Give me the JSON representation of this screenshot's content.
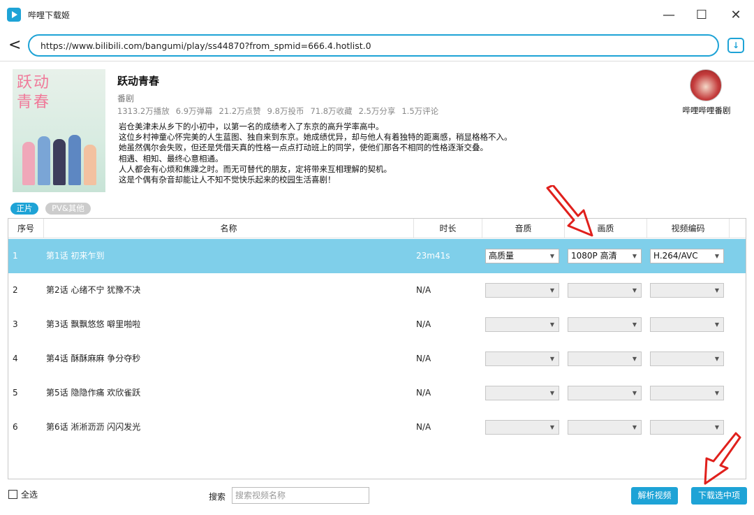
{
  "window": {
    "title": "哔哩下载姬",
    "minimize": "—",
    "maximize": "☐",
    "close": "✕"
  },
  "address": {
    "back": "<",
    "url": "https://www.bilibili.com/bangumi/play/ss44870?from_spmid=666.4.hotlist.0",
    "download_icon": "↓"
  },
  "info": {
    "cover_title": "跃动青春",
    "title": "跃动青春",
    "type": "番剧",
    "stats": [
      "1313.2万播放",
      "6.9万弹幕",
      "21.2万点赞",
      "9.8万投币",
      "71.8万收藏",
      "2.5万分享",
      "1.5万评论"
    ],
    "description": [
      "岩仓美津未从乡下的小初中，以第一名的成绩考入了东京的高升学率高中。",
      "这位乡村神童心怀完美的人生蓝图、独自来到东京。她成绩优异，却与他人有着独特的距离感，稍显格格不入。",
      "她虽然偶尔会失败，但还是凭借天真的性格一点点打动班上的同学，使他们那各不相同的性格逐渐交叠。",
      "相遇、相知、最终心意相通。",
      "人人都会有心烦和焦躁之时。而无可替代的朋友，定将带来互相理解的契机。",
      "这是个偶有杂音却能让人不知不觉快乐起来的校园生活喜剧！"
    ],
    "uploader": "哔哩哔哩番剧"
  },
  "tabs": {
    "main": "正片",
    "other": "PV&其他"
  },
  "table": {
    "headers": {
      "index": "序号",
      "name": "名称",
      "duration": "时长",
      "audio": "音质",
      "quality": "画质",
      "codec": "视频编码"
    },
    "rows": [
      {
        "index": "1",
        "name": "第1话 初来乍到",
        "duration": "23m41s",
        "audio": "高质量",
        "quality": "1080P 高清",
        "codec": "H.264/AVC"
      },
      {
        "index": "2",
        "name": "第2话 心绪不宁 犹豫不决",
        "duration": "N/A",
        "audio": "",
        "quality": "",
        "codec": ""
      },
      {
        "index": "3",
        "name": "第3话 飘飘悠悠 噼里啪啦",
        "duration": "N/A",
        "audio": "",
        "quality": "",
        "codec": ""
      },
      {
        "index": "4",
        "name": "第4话 酥酥麻麻 争分夺秒",
        "duration": "N/A",
        "audio": "",
        "quality": "",
        "codec": ""
      },
      {
        "index": "5",
        "name": "第5话 隐隐作痛 欢欣雀跃",
        "duration": "N/A",
        "audio": "",
        "quality": "",
        "codec": ""
      },
      {
        "index": "6",
        "name": "第6话 淅淅沥沥 闪闪发光",
        "duration": "N/A",
        "audio": "",
        "quality": "",
        "codec": ""
      }
    ]
  },
  "footer": {
    "select_all": "全选",
    "search_label": "搜索",
    "search_placeholder": "搜索视频名称",
    "parse_button": "解析视频",
    "download_button": "下载选中项"
  },
  "colors": {
    "accent": "#1ea3d6",
    "selected_row": "#7fcfea",
    "annotation_arrow": "#e0201c"
  }
}
